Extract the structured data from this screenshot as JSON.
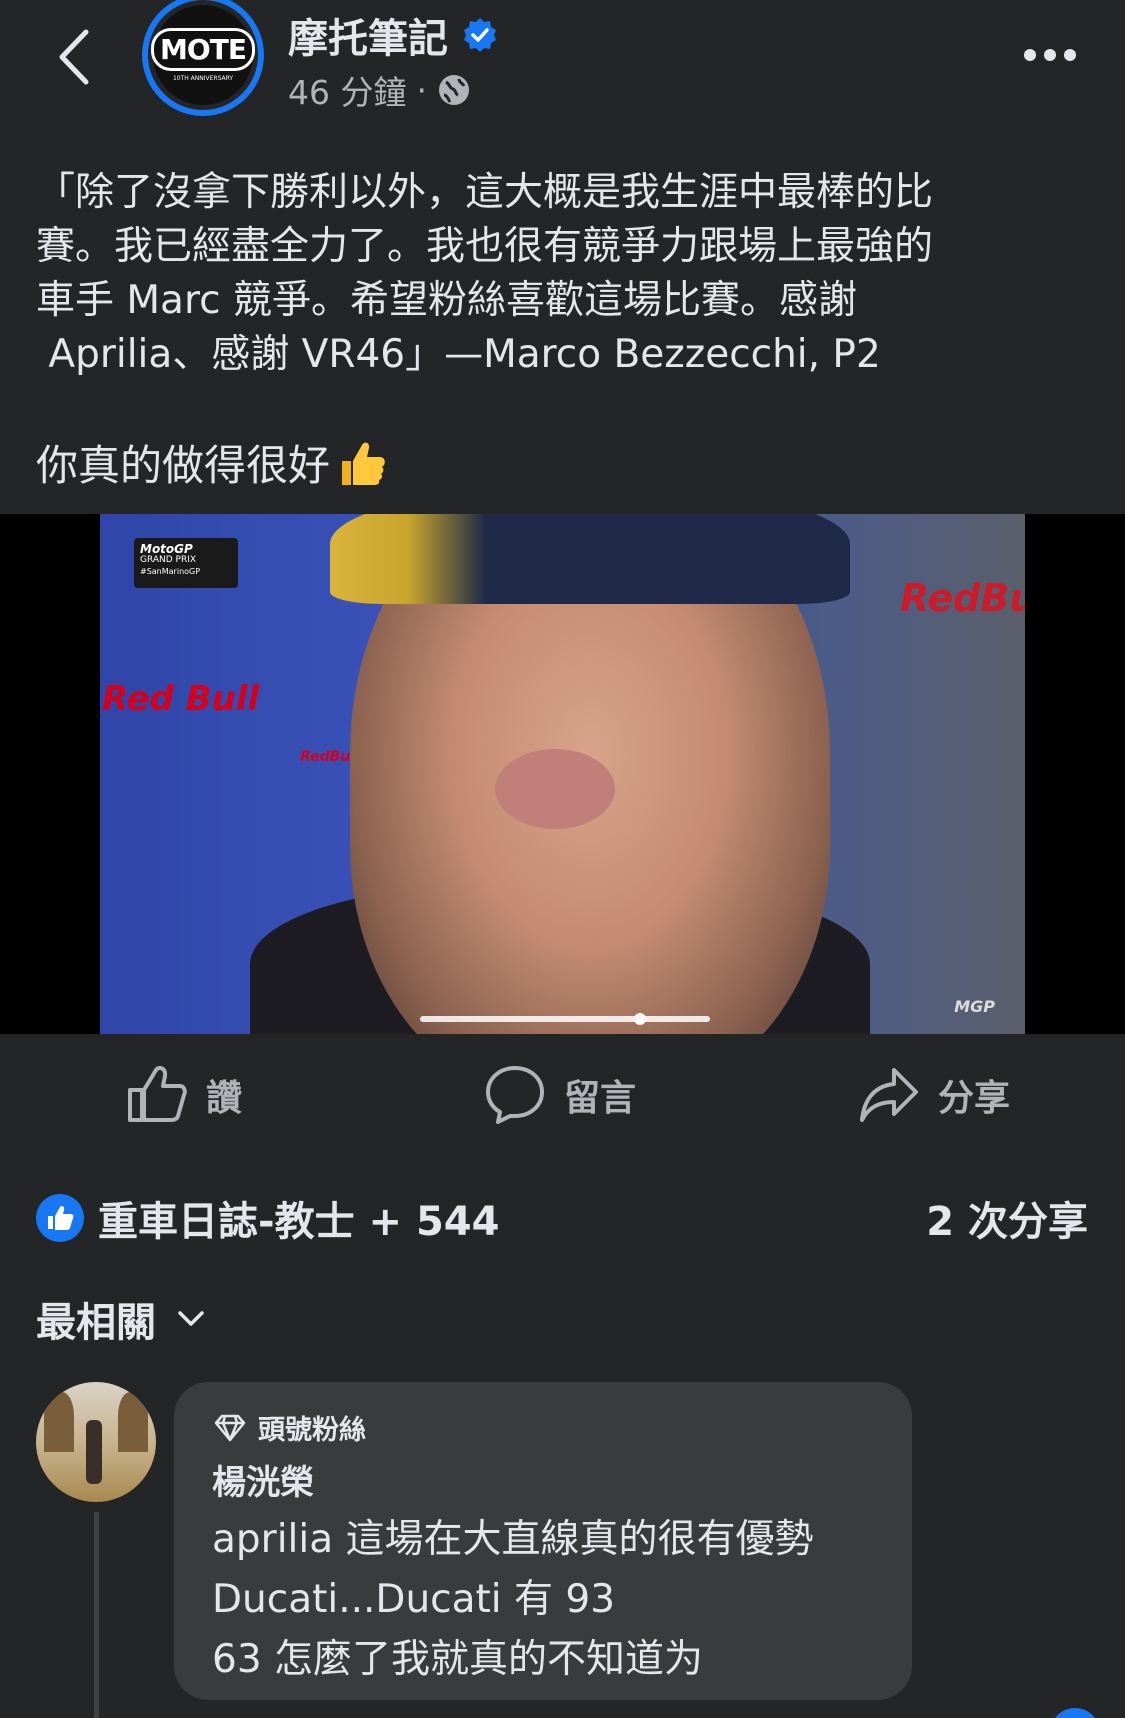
{
  "header": {
    "page_name": "摩托筆記",
    "time": "46 分鐘",
    "separator": "·",
    "logo_text": "MOTE",
    "logo_sub": "10TH ANNIVERSARY"
  },
  "post": {
    "text": "「除了沒拿下勝利以外，這大概是我生涯中最棒的比\n賽。我已經盡全力了。我也很有競爭力跟場上最強的\n車手 Marc 競爭。希望粉絲喜歡這場比賽。感謝\n Aprilia、感謝 VR46」—Marco Bezzecchi, P2",
    "text2": "你真的做得很好"
  },
  "video": {
    "overlay_line1": "MotoGP",
    "overlay_line2": "GRAND PRIX",
    "overlay_line3": "#SanMarinoGP",
    "sponsor1": "Red Bull",
    "sponsor2": "RedBull",
    "corner_logo": "MGP",
    "progress": 0.76
  },
  "actions": {
    "like": "讚",
    "comment": "留言",
    "share": "分享"
  },
  "reactions": {
    "summary": "重車日誌-教士 + 544",
    "shares": "2 次分享"
  },
  "sort": {
    "label": "最相關"
  },
  "comment": {
    "badge": "頭號粉絲",
    "author": "楊洸榮",
    "text": "aprilia 這場在大直線真的很有優勢\nDucati...Ducati 有 93\n63 怎麼了我就真的不知道为"
  },
  "colors": {
    "background": "#242526",
    "accent": "#1877f2",
    "bubble": "#3a3b3c",
    "secondary_text": "#b0b3b8"
  }
}
